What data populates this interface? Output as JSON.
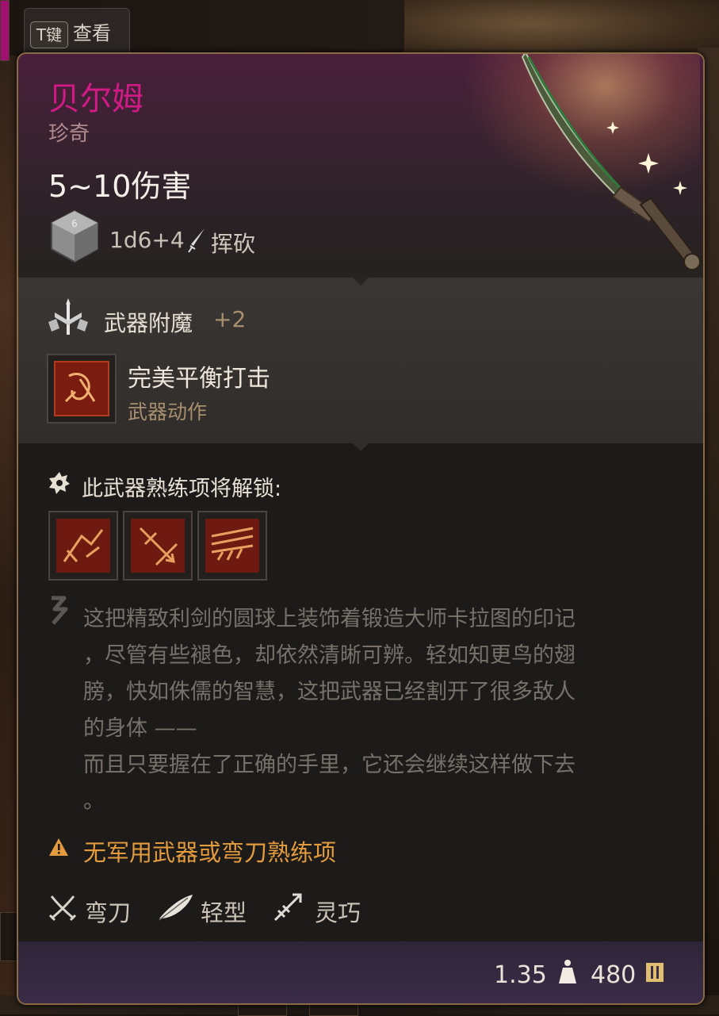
{
  "hint": {
    "key": "T键",
    "label": "查看"
  },
  "item": {
    "name": "贝尔姆",
    "rarity": "珍奇",
    "damage": "5~10伤害",
    "dice_value": "1d6+4",
    "dice_type": "挥砍",
    "enchant_label": "武器附魔",
    "enchant_bonus": "+2"
  },
  "action": {
    "name": "完美平衡打击",
    "type": "武器动作"
  },
  "proficiency": {
    "title": "此武器熟练项将解锁:",
    "slots": [
      "slash-action-icon",
      "pierce-action-icon",
      "cleave-action-icon"
    ]
  },
  "description": {
    "lines": [
      "这把精致利剑的圆球上装饰着锻造大师卡拉图的印记",
      "，尽管有些褪色，却依然清晰可辨。轻如知更鸟的翅",
      "膀，快如侏儒的智慧，这把武器已经割开了很多敌人",
      "的身体 ——",
      "而且只要握在了正确的手里，它还会继续这样做下去",
      "。"
    ]
  },
  "warning": "无军用武器或弯刀熟练项",
  "tags": [
    {
      "icon": "scimitar-icon",
      "label": "弯刀"
    },
    {
      "icon": "feather-icon",
      "label": "轻型"
    },
    {
      "icon": "finesse-icon",
      "label": "灵巧"
    }
  ],
  "footer": {
    "weight": "1.35",
    "price": "480"
  },
  "colors": {
    "rarity_accent": "#d21a86",
    "warning": "#e39b3e",
    "frame": "#8b6a46"
  }
}
